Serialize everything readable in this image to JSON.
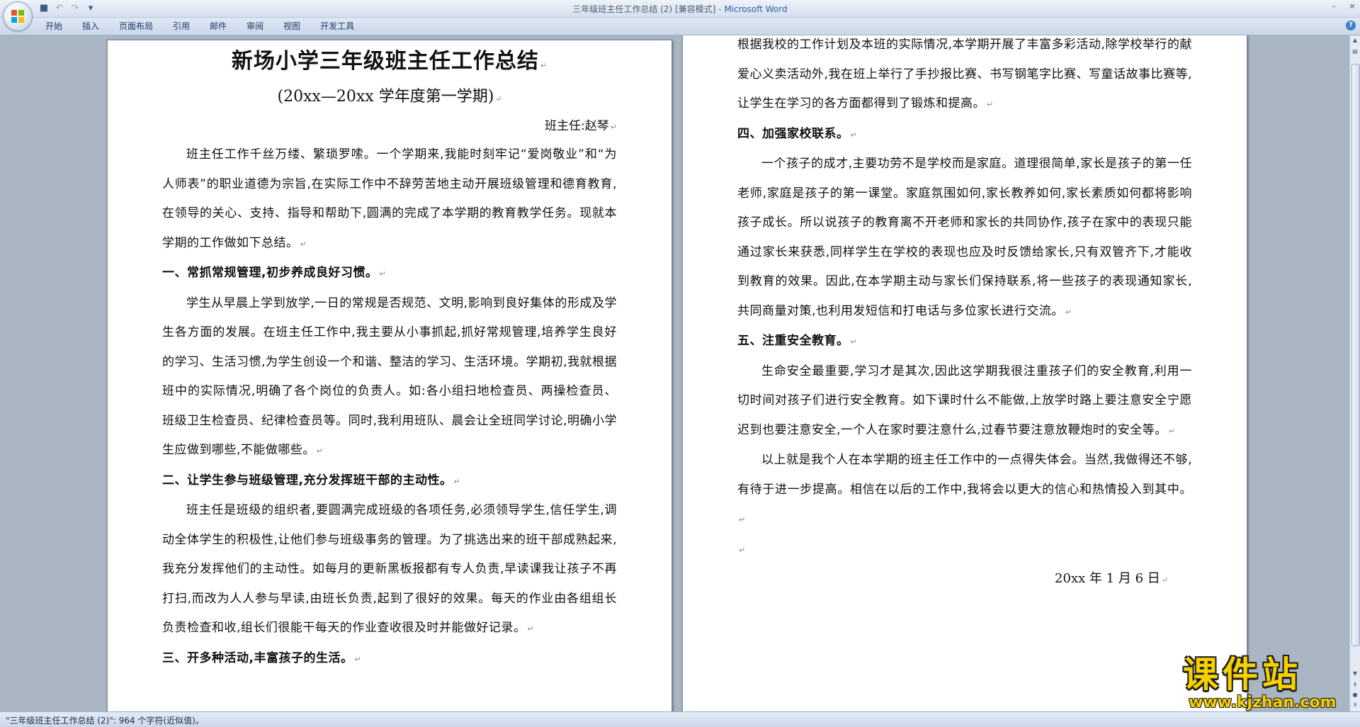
{
  "window": {
    "title_doc": "三年级班主任工作总结 (2) [兼容模式] - ",
    "title_app": "Microsoft Word",
    "minimize": "–",
    "close": "×"
  },
  "qat": {
    "save": "■",
    "undo": "↶",
    "redo": "↷",
    "more": "▾"
  },
  "tabs": [
    "开始",
    "插入",
    "页面布局",
    "引用",
    "邮件",
    "审阅",
    "视图",
    "开发工具"
  ],
  "help": "?",
  "doc": {
    "title": "新场小学三年级班主任工作总结",
    "subtitle": "(20xx—20xx 学年度第一学期)",
    "author": "班主任:赵琴",
    "intro": "班主任工作千丝万缕、繁琐罗嗦。一个学期来,我能时刻牢记“爱岗敬业”和“为人师表”的职业道德为宗旨,在实际工作中不辞劳苦地主动开展班级管理和德育教育,在领导的关心、支持、指导和帮助下,圆满的完成了本学期的教育教学任务。现就本学期的工作做如下总结。",
    "h1": "一、常抓常规管理,初步养成良好习惯。",
    "p1": "学生从早晨上学到放学,一日的常规是否规范、文明,影响到良好集体的形成及学生各方面的发展。在班主任工作中,我主要从小事抓起,抓好常规管理,培养学生良好的学习、生活习惯,为学生创设一个和谐、整洁的学习、生活环境。学期初,我就根据班中的实际情况,明确了各个岗位的负责人。如:各小组扫地检查员、两操检查员、班级卫生检查员、纪律检查员等。同时,我利用班队、晨会让全班同学讨论,明确小学生应做到哪些,不能做哪些。",
    "h2": "二、让学生参与班级管理,充分发挥班干部的主动性。",
    "p2": "班主任是班级的组织者,要圆满完成班级的各项任务,必须领导学生,信任学生,调动全体学生的积极性,让他们参与班级事务的管理。为了挑选出来的班干部成熟起来,我充分发挥他们的主动性。如每月的更新黑板报都有专人负责,早读课我让孩子不再打扫,而改为人人参与早读,由班长负责,起到了很好的效果。每天的作业由各组组长负责检查和收,组长们很能干每天的作业查收很及时并能做好记录。",
    "h3": "三、开多种活动,丰富孩子的生活。",
    "p3_cont": "根据我校的工作计划及本班的实际情况,本学期开展了丰富多彩活动,除学校举行的献爱心义卖活动外,我在班上举行了手抄报比赛、书写钢笔字比赛、写童话故事比赛等,让学生在学习的各方面都得到了锻炼和提高。",
    "h4": "四、加强家校联系。",
    "p4": "一个孩子的成才,主要功劳不是学校而是家庭。道理很简单,家长是孩子的第一任老师,家庭是孩子的第一课堂。家庭氛围如何,家长教养如何,家长素质如何都将影响孩子成长。所以说孩子的教育离不开老师和家长的共同协作,孩子在家中的表现只能通过家长来获悉,同样学生在学校的表现也应及时反馈给家长,只有双管齐下,才能收到教育的效果。因此,在本学期主动与家长们保持联系,将一些孩子的表现通知家长,共同商量对策,也利用发短信和打电话与多位家长进行交流。",
    "h5": "五、注重安全教育。",
    "p5": "生命安全最重要,学习才是其次,因此这学期我很注重孩子们的安全教育,利用一切时间对孩子们进行安全教育。如下课时什么不能做,上放学时路上要注意安全宁愿迟到也要注意安全,一个人在家时要注意什么,过春节要注意放鞭炮时的安全等。",
    "p6": "以上就是我个人在本学期的班主任工作中的一点得失体会。当然,我做得还不够,有待于进一步提高。相信在以后的工作中,我将会以更大的信心和热情投入到其中。",
    "date": "20xx 年 1 月 6 日",
    "para_mark": "↵"
  },
  "statusbar": {
    "text": "\"三年级班主任工作总结 (2)\": 964 个字符(近似值)。"
  },
  "logo": {
    "main": "课件站",
    "url": "www.kjzhan.com"
  },
  "colors": {
    "accent": "#2d5fa8",
    "logo_yellow": "#f6d100"
  }
}
